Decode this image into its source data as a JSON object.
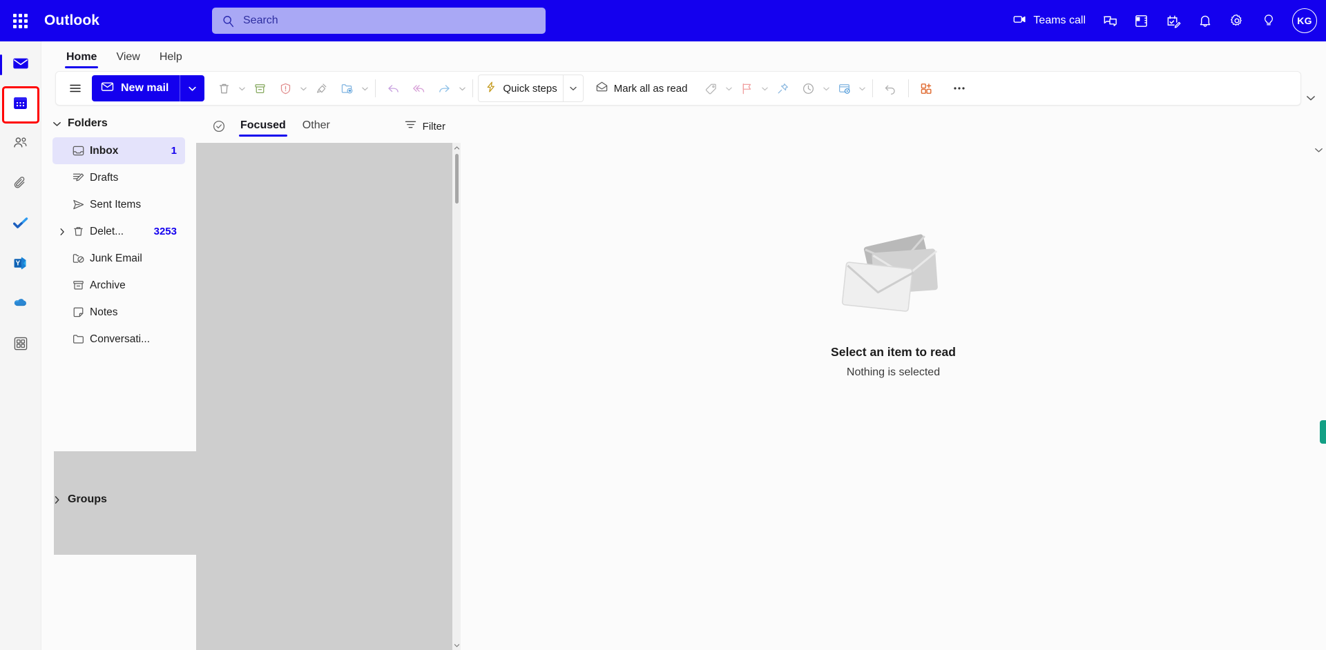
{
  "header": {
    "brand": "Outlook",
    "waffle_icon": "app-launcher-waffle-icon",
    "search": {
      "placeholder": "Search",
      "value": "",
      "icon": "search-icon"
    },
    "teams_call_label": "Teams call",
    "teams_call_icon": "video-camera-icon",
    "icons": [
      {
        "name": "chat-icon",
        "label": "Chat"
      },
      {
        "name": "onenote-icon",
        "label": "OneNote feed"
      },
      {
        "name": "to-do-icon",
        "label": "My Day"
      },
      {
        "name": "notifications-bell-icon",
        "label": "Notifications"
      },
      {
        "name": "settings-gear-icon",
        "label": "Settings"
      },
      {
        "name": "lightbulb-help-icon",
        "label": "Help"
      }
    ],
    "avatar": {
      "initials": "KG",
      "name": "account-avatar"
    }
  },
  "app_rail": {
    "items": [
      {
        "name": "sidebar-item-mail",
        "label": "Mail",
        "icon": "mail-envelope-icon",
        "selected": true,
        "highlighted": false
      },
      {
        "name": "sidebar-item-calendar",
        "label": "Calendar",
        "icon": "calendar-icon",
        "selected": false,
        "highlighted": true
      },
      {
        "name": "sidebar-item-people",
        "label": "People",
        "icon": "people-icon",
        "selected": false,
        "highlighted": false
      },
      {
        "name": "sidebar-item-attachments",
        "label": "Files",
        "icon": "paperclip-icon",
        "selected": false,
        "highlighted": false
      },
      {
        "name": "sidebar-item-todo",
        "label": "To Do",
        "icon": "todo-checkmark-icon",
        "selected": false,
        "highlighted": false
      },
      {
        "name": "sidebar-item-viva-engage",
        "label": "Viva Engage",
        "icon": "viva-engage-y-icon",
        "selected": false,
        "highlighted": false
      },
      {
        "name": "sidebar-item-onedrive",
        "label": "OneDrive",
        "icon": "onedrive-cloud-icon",
        "selected": false,
        "highlighted": false
      },
      {
        "name": "sidebar-item-apps",
        "label": "Apps",
        "icon": "apps-grid-icon",
        "selected": false,
        "highlighted": false
      }
    ]
  },
  "ribbon": {
    "tabs": [
      {
        "label": "Home",
        "active": true
      },
      {
        "label": "View",
        "active": false
      },
      {
        "label": "Help",
        "active": false
      }
    ],
    "collapse_icon": "chevron-down-icon"
  },
  "toolbar": {
    "hamburger_icon": "hamburger-menu-icon",
    "new_mail_label": "New mail",
    "new_mail_icon": "envelope-icon",
    "new_mail_caret_icon": "chevron-down-icon",
    "commands": [
      {
        "name": "delete-button",
        "label": "Delete",
        "icon": "trash-icon",
        "caret": true
      },
      {
        "name": "archive-button",
        "label": "Archive",
        "icon": "archive-box-icon",
        "caret": false
      },
      {
        "name": "report-button",
        "label": "Report",
        "icon": "shield-alert-icon",
        "caret": true
      },
      {
        "name": "sweep-button",
        "label": "Sweep",
        "icon": "broom-icon",
        "caret": false
      },
      {
        "name": "move-to-button",
        "label": "Move to",
        "icon": "folder-arrow-icon",
        "caret": true
      },
      {
        "name": "reply-button",
        "label": "Reply",
        "icon": "reply-arrow-icon",
        "caret": false
      },
      {
        "name": "reply-all-button",
        "label": "Reply all",
        "icon": "reply-all-arrow-icon",
        "caret": false
      },
      {
        "name": "forward-button",
        "label": "Forward",
        "icon": "forward-arrow-icon",
        "caret": true
      }
    ],
    "quick_steps_label": "Quick steps",
    "quick_steps_icon": "lightning-bolt-icon",
    "quick_steps_caret_icon": "chevron-down-icon",
    "mark_all_read_label": "Mark all as read",
    "mark_all_read_icon": "open-envelope-icon",
    "trailing_commands": [
      {
        "name": "categorize-button",
        "label": "Categorize",
        "icon": "tag-icon",
        "caret": true
      },
      {
        "name": "flag-button",
        "label": "Flag",
        "icon": "flag-icon",
        "caret": true
      },
      {
        "name": "pin-button",
        "label": "Pin",
        "icon": "pin-icon",
        "caret": false
      },
      {
        "name": "snooze-button",
        "label": "Snooze",
        "icon": "clock-icon",
        "caret": true
      },
      {
        "name": "rules-button",
        "label": "Rules",
        "icon": "rules-gear-icon",
        "caret": true
      }
    ],
    "undo_label": "Undo",
    "undo_icon": "undo-arrow-icon",
    "addins_label": "Apps",
    "addins_icon": "add-ins-grid-plus-icon",
    "overflow_label": "More options",
    "overflow_icon": "ellipsis-icon"
  },
  "folder_pane": {
    "folders_section": {
      "title": "Folders",
      "caret_icon": "chevron-down-icon",
      "expanded": true
    },
    "items": [
      {
        "name": "folder-inbox",
        "label": "Inbox",
        "icon": "inbox-icon",
        "count": "1",
        "selected": true,
        "expandable": false
      },
      {
        "name": "folder-drafts",
        "label": "Drafts",
        "icon": "drafts-pencil-icon",
        "count": "",
        "selected": false,
        "expandable": false
      },
      {
        "name": "folder-sent-items",
        "label": "Sent Items",
        "icon": "sent-paper-plane-icon",
        "count": "",
        "selected": false,
        "expandable": false
      },
      {
        "name": "folder-deleted-items",
        "label": "Delet...",
        "icon": "trash-icon",
        "count": "3253",
        "selected": false,
        "expandable": true
      },
      {
        "name": "folder-junk-email",
        "label": "Junk Email",
        "icon": "junk-folder-icon",
        "count": "",
        "selected": false,
        "expandable": false
      },
      {
        "name": "folder-archive",
        "label": "Archive",
        "icon": "archive-box-icon",
        "count": "",
        "selected": false,
        "expandable": false
      },
      {
        "name": "folder-notes",
        "label": "Notes",
        "icon": "note-icon",
        "count": "",
        "selected": false,
        "expandable": false
      },
      {
        "name": "folder-conversation-history",
        "label": "Conversati...",
        "icon": "folder-icon",
        "count": "",
        "selected": false,
        "expandable": false
      }
    ],
    "groups_section": {
      "title": "Groups",
      "caret_icon": "chevron-right-icon",
      "expanded": false
    }
  },
  "message_list": {
    "select_all_icon": "circle-check-icon",
    "tabs": [
      {
        "label": "Focused",
        "active": true
      },
      {
        "label": "Other",
        "active": false
      }
    ],
    "filter_label": "Filter",
    "filter_icon": "filter-icon",
    "messages": [],
    "scrollbar": {
      "up_icon": "caret-up-icon",
      "down_icon": "caret-down-icon"
    }
  },
  "reading_pane": {
    "empty_title": "Select an item to read",
    "empty_subtitle": "Nothing is selected",
    "illustration": "stacked-envelopes-illustration"
  },
  "colors": {
    "brand_blue": "#1400ee",
    "search_bg": "#a9a8f5",
    "selected_folder_bg": "#e4e3fb",
    "highlight_outline": "#ff0000",
    "list_body": "#cecece",
    "accent_green": "#13a085"
  }
}
